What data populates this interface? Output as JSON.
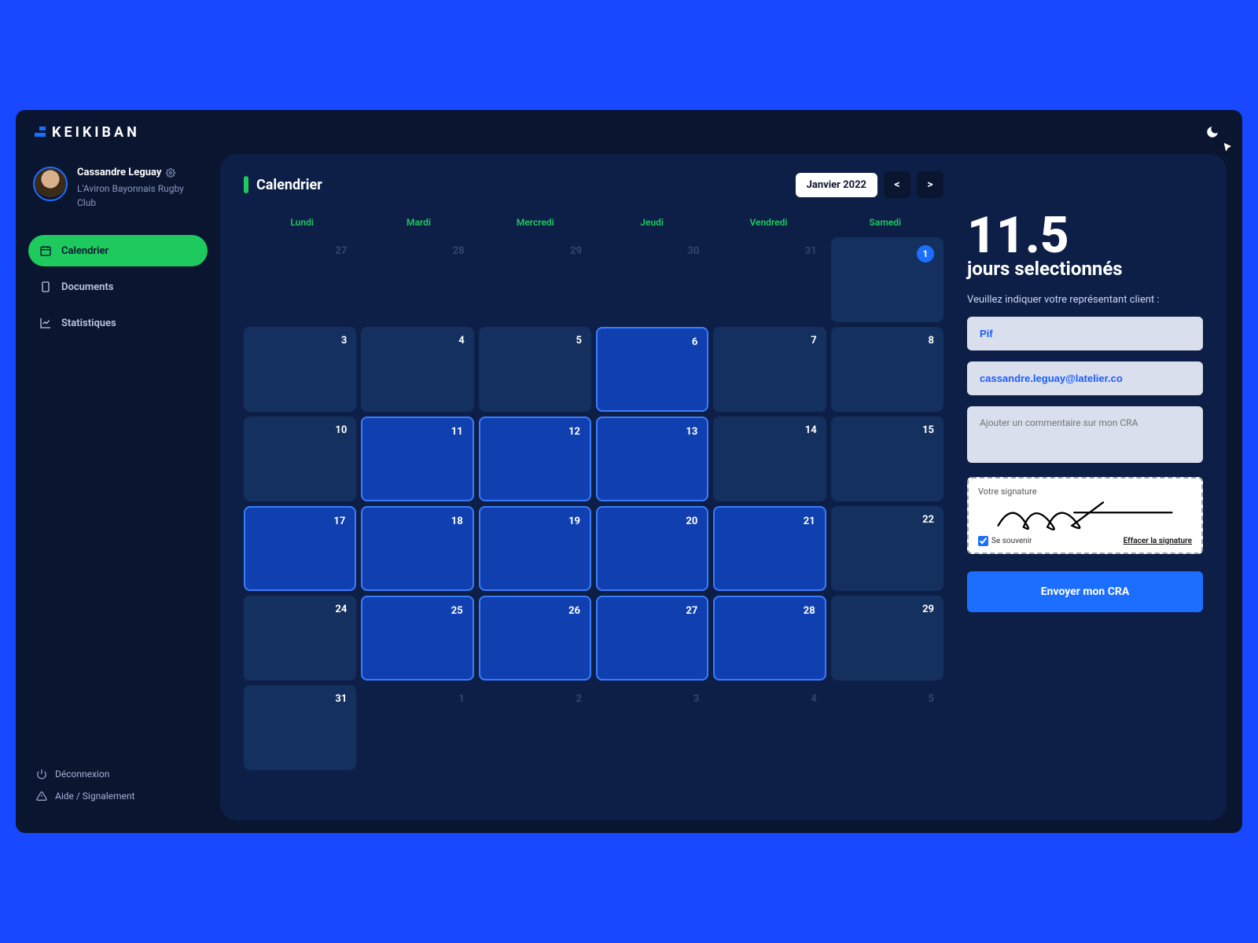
{
  "brand": "KEIKIBAN",
  "user": {
    "name": "Cassandre Leguay",
    "org": "L'Aviron Bayonnais Rugby Club"
  },
  "sidebar": {
    "items": [
      {
        "label": "Calendrier",
        "icon": "calendar-icon",
        "active": true
      },
      {
        "label": "Documents",
        "icon": "document-icon",
        "active": false
      },
      {
        "label": "Statistiques",
        "icon": "chart-icon",
        "active": false
      }
    ],
    "logout": "Déconnexion",
    "help": "Aide / Signalement"
  },
  "calendar": {
    "title": "Calendrier",
    "month_label": "Janvier 2022",
    "prev": "<",
    "next": ">",
    "weekdays": [
      "Lundi",
      "Mardi",
      "Mercredi",
      "Jeudi",
      "Vendredi",
      "Samedi"
    ],
    "cells": [
      {
        "n": "27",
        "state": "muted"
      },
      {
        "n": "28",
        "state": "muted"
      },
      {
        "n": "29",
        "state": "muted"
      },
      {
        "n": "30",
        "state": "muted"
      },
      {
        "n": "31",
        "state": "muted"
      },
      {
        "n": "1",
        "state": "normal",
        "badge": true
      },
      {
        "n": "3",
        "state": "normal"
      },
      {
        "n": "4",
        "state": "normal"
      },
      {
        "n": "5",
        "state": "normal"
      },
      {
        "n": "6",
        "state": "selected"
      },
      {
        "n": "7",
        "state": "normal"
      },
      {
        "n": "8",
        "state": "normal"
      },
      {
        "n": "10",
        "state": "normal"
      },
      {
        "n": "11",
        "state": "selected"
      },
      {
        "n": "12",
        "state": "selected"
      },
      {
        "n": "13",
        "state": "selected"
      },
      {
        "n": "14",
        "state": "normal"
      },
      {
        "n": "15",
        "state": "normal"
      },
      {
        "n": "17",
        "state": "selected"
      },
      {
        "n": "18",
        "state": "selected"
      },
      {
        "n": "19",
        "state": "selected"
      },
      {
        "n": "20",
        "state": "selected"
      },
      {
        "n": "21",
        "state": "selected"
      },
      {
        "n": "22",
        "state": "normal"
      },
      {
        "n": "24",
        "state": "normal"
      },
      {
        "n": "25",
        "state": "selected"
      },
      {
        "n": "26",
        "state": "selected"
      },
      {
        "n": "27",
        "state": "selected"
      },
      {
        "n": "28",
        "state": "selected"
      },
      {
        "n": "29",
        "state": "normal"
      },
      {
        "n": "31",
        "state": "normal"
      },
      {
        "n": "1",
        "state": "muted"
      },
      {
        "n": "2",
        "state": "muted"
      },
      {
        "n": "3",
        "state": "muted"
      },
      {
        "n": "4",
        "state": "muted"
      },
      {
        "n": "5",
        "state": "muted"
      }
    ]
  },
  "panel": {
    "count": "11.5",
    "unit": "jours selectionnés",
    "prompt": "Veuillez indiquer votre représentant client :",
    "rep_value": "Pif",
    "email_value": "cassandre.leguay@latelier.co",
    "comment_placeholder": "Ajouter un commentaire sur mon CRA",
    "signature_label": "Votre signature",
    "remember_label": "Se souvenir",
    "clear_signature": "Effacer la signature",
    "cta": "Envoyer mon CRA"
  }
}
